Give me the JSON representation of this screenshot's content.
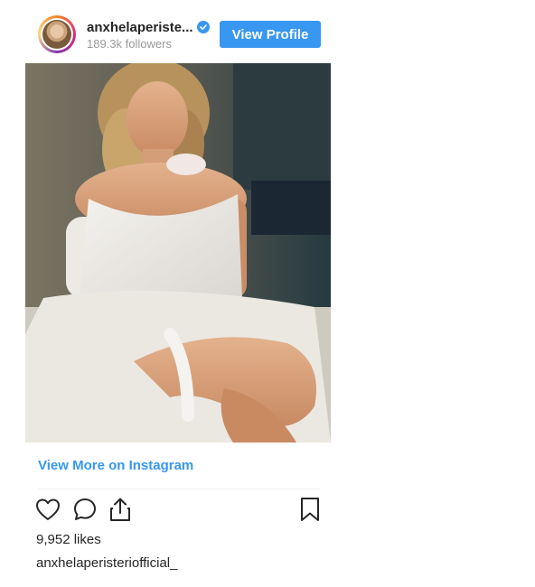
{
  "header": {
    "username": "anxhelaperiste...",
    "followers": "189.3k followers",
    "view_profile_label": "View Profile",
    "avatar_icon": "profile-avatar",
    "verified_icon": "verified-badge-icon"
  },
  "post": {
    "image_alt": "Instagram post photo",
    "view_more_label": "View More on Instagram"
  },
  "actions": {
    "like_icon": "heart-icon",
    "comment_icon": "comment-icon",
    "share_icon": "share-icon",
    "save_icon": "bookmark-icon"
  },
  "stats": {
    "likes": "9,952 likes",
    "caption_username": "anxhelaperisteriofficial_"
  },
  "colors": {
    "accent": "#3897f0",
    "text": "#262626",
    "muted": "#999999",
    "divider": "#efefef"
  }
}
